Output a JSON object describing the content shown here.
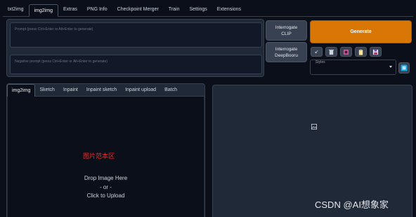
{
  "tabs": [
    "txt2img",
    "img2img",
    "Extras",
    "PNG Info",
    "Checkpoint Merger",
    "Train",
    "Settings",
    "Extensions"
  ],
  "active_tab": "img2img",
  "prompt": {
    "placeholder": "Prompt (press Ctrl+Enter or Alt+Enter to generate)",
    "value": ""
  },
  "negative_prompt": {
    "placeholder": "Negative prompt (press Ctrl+Enter or Alt+Enter to generate)",
    "value": ""
  },
  "buttons": {
    "interrogate_clip": "Interrogate\nCLIP",
    "interrogate_deepbooru": "Interrogate\nDeepBooru",
    "generate": "Generate"
  },
  "tool_icons": [
    "arrow-icon",
    "trash-icon",
    "pink-square-icon",
    "clipboard-icon",
    "save-icon"
  ],
  "styles": {
    "label": "Styles",
    "value": ""
  },
  "subtabs": [
    "img2img",
    "Sketch",
    "Inpaint",
    "Inpaint sketch",
    "Inpaint upload",
    "Batch"
  ],
  "active_subtab": "img2img",
  "image_area": {
    "overlay_label": "图片范本区",
    "drop_line1": "Drop Image Here",
    "drop_line2": "- or -",
    "drop_line3": "Click to Upload"
  },
  "watermark": "CSDN @AI想象家",
  "colors": {
    "background": "#0b0f19",
    "panel": "#1f2937",
    "generate": "#d97706",
    "overlay_label": "#ef2b2b"
  }
}
